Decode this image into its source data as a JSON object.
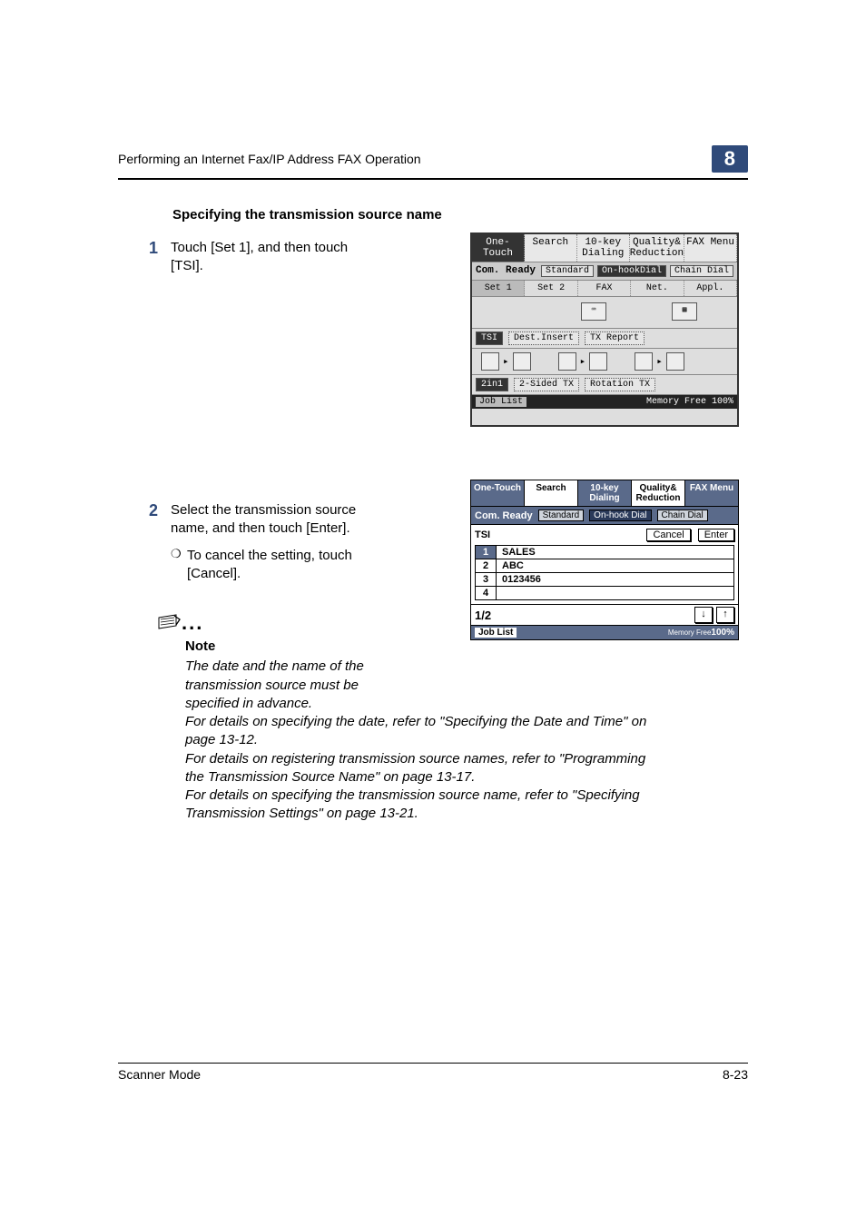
{
  "header": {
    "title": "Performing an Internet Fax/IP Address FAX Operation",
    "chapter": "8"
  },
  "section_heading": "Specifying the transmission source name",
  "steps": [
    {
      "number": "1",
      "text": "Touch [Set 1], and then touch [TSI]."
    },
    {
      "number": "2",
      "text": "Select the transmission source name, and then touch [Enter].",
      "sub": "To cancel the setting, touch [Cancel]."
    }
  ],
  "note": {
    "label": "Note",
    "narrow": "The date and the name of the transmission source must be specified in advance.",
    "wide1": "For details on specifying the date, refer to \"Specifying the Date and Time\" on page 13-12.",
    "wide2": "For details on registering transmission source names, refer to \"Programming the Transmission Source Name\" on page 13-17.",
    "wide3": "For details on specifying the transmission source name, refer to \"Specifying Transmission Settings\" on page 13-21."
  },
  "footer": {
    "left": "Scanner Mode",
    "right": "8-23"
  },
  "screen1": {
    "tabs": [
      "One-Touch",
      "Search",
      "10-key Dialing",
      "Quality& Reduction",
      "FAX Menu"
    ],
    "status": "Com. Ready",
    "status_btns": [
      "Standard",
      "On-hookDial",
      "Chain Dial"
    ],
    "subtabs": [
      "Set 1",
      "Set 2",
      "FAX",
      "Net.",
      "Appl."
    ],
    "mid_btns": [
      "TSI",
      "Dest.Insert",
      "TX Report"
    ],
    "bottom_btns": [
      "2in1",
      "2-Sided TX",
      "Rotation TX"
    ],
    "joblist": "Job List",
    "memory": "Memory Free 100%"
  },
  "screen2": {
    "tabs": [
      "One-Touch",
      "Search",
      "10-key Dialing",
      "Quality& Reduction",
      "FAX Menu"
    ],
    "status": "Com. Ready",
    "status_btns": [
      "Standard",
      "On-hook Dial",
      "Chain Dial"
    ],
    "tsi": "TSI",
    "cancel": "Cancel",
    "enter": "Enter",
    "items": [
      {
        "num": "1",
        "val": "SALES"
      },
      {
        "num": "2",
        "val": "ABC"
      },
      {
        "num": "3",
        "val": "0123456"
      },
      {
        "num": "4",
        "val": ""
      }
    ],
    "page": "1/2",
    "joblist": "Job List",
    "mem_label": "Memory Free",
    "mem_value": "100%"
  }
}
